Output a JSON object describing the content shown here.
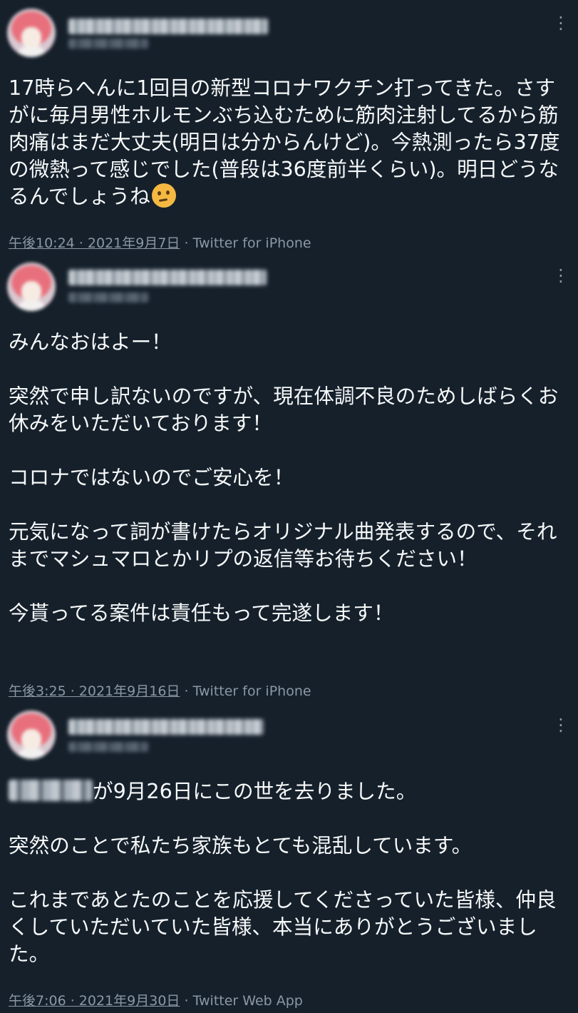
{
  "tweets": [
    {
      "text": "17時らへんに1回目の新型コロナワクチン打ってきた。さすがに毎月男性ホルモンぶち込むために筋肉注射してるから筋肉痛はまだ大丈夫(明日は分からんけど)。今熱測ったら37度の微熱って感じでした(普段は36度前半くらい)。明日どうなるんでしょうね",
      "emoji": "thinking-face-emoji",
      "time": "午後10:24",
      "date": "2021年9月7日",
      "source": "Twitter for iPhone"
    },
    {
      "text": "みんなおはよー！\n\n突然で申し訳ないのですが、現在体調不良のためしばらくお休みをいただいております！\n\nコロナではないのでご安心を！\n\n元気になって詞が書けたらオリジナル曲発表するので、それまでマシュマロとかリプの返信等お待ちください！\n\n今貰ってる案件は責任もって完遂します！",
      "time": "午後3:25",
      "date": "2021年9月16日",
      "source": "Twitter for iPhone"
    },
    {
      "text_after_blur": "が9月26日にこの世を去りました。\n\n突然のことで私たち家族もとても混乱しています。\n\nこれまであとたのことを応援してくださっていた皆様、仲良くしていただいていた皆様、本当にありがとうございました。",
      "time": "午後7:06",
      "date": "2021年9月30日",
      "source": "Twitter Web App"
    }
  ],
  "separator": " · ",
  "more_icon": "⋮",
  "colors": {
    "background": "#15202b",
    "text": "#f7f9f9",
    "muted": "#8b98a5"
  }
}
